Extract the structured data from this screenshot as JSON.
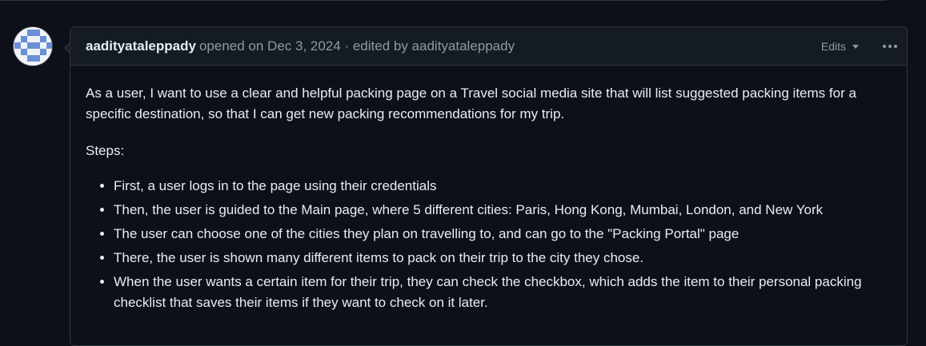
{
  "issue": {
    "author": "aadityataleppady",
    "opened_text": "opened on Dec 3, 2024",
    "separator": " · ",
    "edited_text": "edited by aadityataleppady",
    "edits_label": "Edits",
    "story": "As a user, I want to use a clear and helpful packing page on a Travel social media site that will list suggested packing items for a specific destination, so that I can get new packing recommendations for my trip.",
    "steps_heading": "Steps:",
    "steps": [
      "First, a user logs in to the page using their credentials",
      "Then, the user is guided to the Main page, where 5 different cities: Paris, Hong Kong, Mumbai, London, and New York",
      "The user can choose one of the cities they plan on travelling to, and can go to the \"Packing Portal\" page",
      "There, the user is shown many different items to pack on their trip to the city they chose.",
      "When the user wants a certain item for their trip, they can check the checkbox, which adds the item to their personal packing checklist that saves their items if they want to check on it later."
    ]
  },
  "colors": {
    "background": "#0d1117",
    "header_bg": "#151b23",
    "border": "#30363d",
    "text": "#e6edf3",
    "muted": "#9198a1",
    "avatar_pattern": "#6b8fd6"
  },
  "icons": {
    "avatar": "identicon-avatar",
    "edits_dropdown": "chevron-down-icon",
    "more_actions": "kebab-horizontal-icon"
  }
}
